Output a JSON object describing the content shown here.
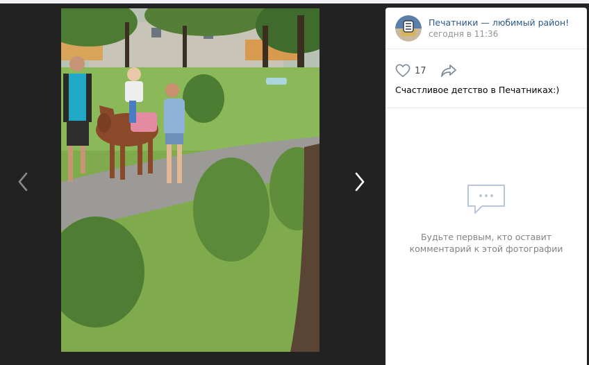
{
  "post": {
    "author": "Печатники — любимый район!",
    "time": "сегодня в 11:36",
    "likes": "17",
    "text": "Счастливое детство в Печатниках:)"
  },
  "comments": {
    "empty_line1": "Будьте первым, кто оставит",
    "empty_line2": "комментарий к этой фотографии"
  },
  "icons": {
    "prev": "chevron-left-icon",
    "next": "chevron-right-icon",
    "like": "heart-icon",
    "share": "share-arrow-icon",
    "empty": "comment-bubble-icon"
  },
  "colors": {
    "link": "#2a5885",
    "muted": "#939393",
    "backdrop": "#222222"
  }
}
